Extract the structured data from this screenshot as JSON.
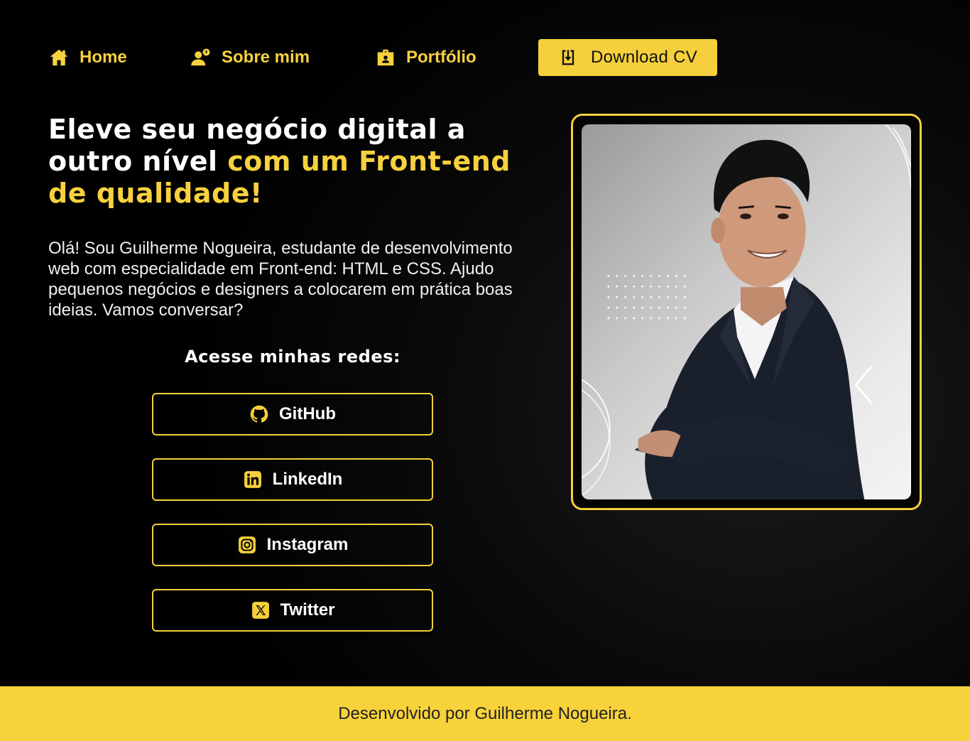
{
  "nav": {
    "home": {
      "label": "Home",
      "icon": "home-icon"
    },
    "about": {
      "label": "Sobre mim",
      "icon": "user-info-icon"
    },
    "portfolio": {
      "label": "Portfólio",
      "icon": "briefcase-icon"
    },
    "cv": {
      "label": "Download CV",
      "icon": "download-icon"
    }
  },
  "hero": {
    "title_plain": "Eleve seu negócio digital a outro nível ",
    "title_highlight": "com um Front-end de qualidade!",
    "intro": "Olá! Sou Guilherme Nogueira, estudante de desenvolvimento web com especialidade em Front-end: HTML e CSS. Ajudo pequenos negócios e designers a colocarem em prática boas ideias. Vamos conversar?"
  },
  "social": {
    "heading": "Acesse minhas redes:",
    "items": [
      {
        "label": "GitHub",
        "icon": "github-icon"
      },
      {
        "label": "LinkedIn",
        "icon": "linkedin-icon"
      },
      {
        "label": "Instagram",
        "icon": "instagram-icon"
      },
      {
        "label": "Twitter",
        "icon": "x-twitter-icon"
      }
    ]
  },
  "footer": {
    "text": "Desenvolvido por Guilherme Nogueira."
  },
  "colors": {
    "accent": "#f5cf3c",
    "background": "#000000",
    "text": "#ffffff"
  }
}
